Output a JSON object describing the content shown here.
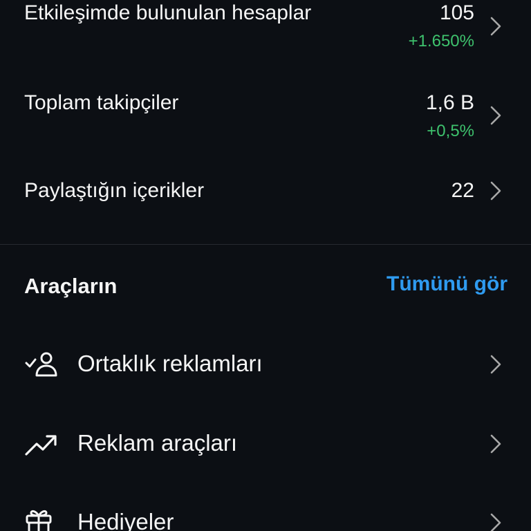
{
  "stats": [
    {
      "label": "Etkileşimde bulunulan hesaplar",
      "value": "105",
      "change": "+1.650%"
    },
    {
      "label": "Toplam takipçiler",
      "value": "1,6 B",
      "change": "+0,5%"
    },
    {
      "label": "Paylaştığın içerikler",
      "value": "22"
    }
  ],
  "tools": {
    "title": "Araçların",
    "see_all": "Tümünü gör",
    "items": [
      {
        "label": "Ortaklık reklamları",
        "icon": "partner-person-check-icon"
      },
      {
        "label": "Reklam araçları",
        "icon": "trending-up-icon"
      },
      {
        "label": "Hediyeler",
        "icon": "gift-icon"
      }
    ]
  },
  "colors": {
    "background": "#0c0f14",
    "text": "#f5f5f5",
    "positive": "#3ec26d",
    "link": "#2f9bf0",
    "chevron": "#a8a8a8",
    "divider": "#262a30"
  }
}
